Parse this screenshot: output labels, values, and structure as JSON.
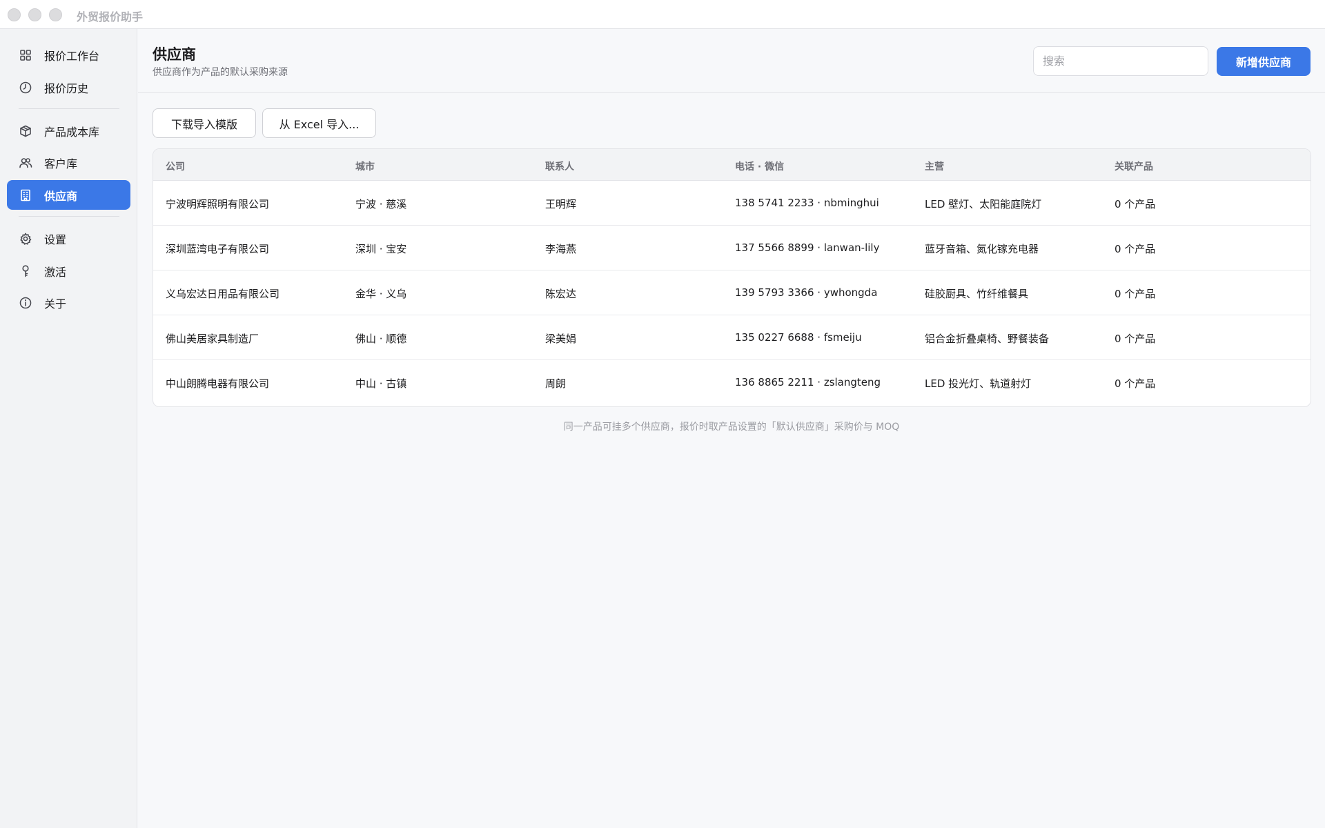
{
  "app": {
    "title": "外贸报价助手"
  },
  "sidebar": {
    "items": [
      {
        "label": "报价工作台",
        "icon": "grid-icon"
      },
      {
        "label": "报价历史",
        "icon": "clock-icon"
      },
      {
        "label": "产品成本库",
        "icon": "box-icon"
      },
      {
        "label": "客户库",
        "icon": "users-icon"
      },
      {
        "label": "供应商",
        "icon": "building-icon",
        "active": true
      },
      {
        "label": "设置",
        "icon": "gear-icon"
      },
      {
        "label": "激活",
        "icon": "key-icon"
      },
      {
        "label": "关于",
        "icon": "info-icon"
      }
    ]
  },
  "header": {
    "title": "供应商",
    "subtitle": "供应商作为产品的默认采购来源",
    "search_placeholder": "搜索",
    "add_button": "新增供应商"
  },
  "toolbar": {
    "download_template": "下载导入模版",
    "import_excel": "从 Excel 导入..."
  },
  "table": {
    "columns": [
      "公司",
      "城市",
      "联系人",
      "电话 · 微信",
      "主营",
      "关联产品"
    ],
    "rows": [
      [
        "宁波明辉照明有限公司",
        "宁波 · 慈溪",
        "王明辉",
        "138 5741 2233 · nbminghui",
        "LED 壁灯、太阳能庭院灯",
        "0 个产品"
      ],
      [
        "深圳蓝湾电子有限公司",
        "深圳 · 宝安",
        "李海燕",
        "137 5566 8899 · lanwan-lily",
        "蓝牙音箱、氮化镓充电器",
        "0 个产品"
      ],
      [
        "义乌宏达日用品有限公司",
        "金华 · 义乌",
        "陈宏达",
        "139 5793 3366 · ywhongda",
        "硅胶厨具、竹纤维餐具",
        "0 个产品"
      ],
      [
        "佛山美居家具制造厂",
        "佛山 · 顺德",
        "梁美娟",
        "135 0227 6688 · fsmeiju",
        "铝合金折叠桌椅、野餐装备",
        "0 个产品"
      ],
      [
        "中山朗腾电器有限公司",
        "中山 · 古镇",
        "周朗",
        "136 8865 2211 · zslangteng",
        "LED 投光灯、轨道射灯",
        "0 个产品"
      ]
    ]
  },
  "footnote": "同一产品可挂多个供应商，报价时取产品设置的「默认供应商」采购价与 MOQ",
  "colors": {
    "accent": "#3b78e7",
    "sidebar_bg": "#f2f3f5",
    "main_bg": "#f7f8fa"
  }
}
